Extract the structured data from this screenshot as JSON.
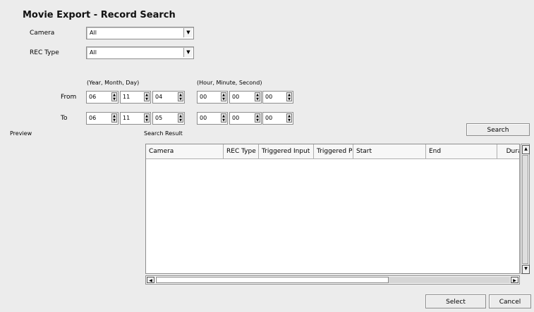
{
  "window": {
    "title": "Movie Export - Record Search"
  },
  "filters": {
    "camera": {
      "label": "Camera",
      "value": "All"
    },
    "rec_type": {
      "label": "REC Type",
      "value": "All"
    }
  },
  "datetime": {
    "date_header": "(Year, Month, Day)",
    "time_header": "(Hour, Minute, Second)",
    "from": {
      "label": "From",
      "year": "06",
      "month": "11",
      "day": "04",
      "hour": "00",
      "minute": "00",
      "second": "00"
    },
    "to": {
      "label": "To",
      "year": "06",
      "month": "11",
      "day": "05",
      "hour": "00",
      "minute": "00",
      "second": "00"
    }
  },
  "preview": {
    "label": "Preview"
  },
  "results": {
    "label": "Search Result",
    "columns": [
      "Camera",
      "REC Type",
      "Triggered Input",
      "Triggered Pin",
      "Start",
      "End",
      "Durat"
    ]
  },
  "buttons": {
    "search": "Search",
    "select": "Select",
    "cancel": "Cancel"
  },
  "icons": {
    "dropdown": "chevron-down-icon",
    "spinner": "up-down-arrows-icon",
    "scroll_up": "arrow-up-icon",
    "scroll_down": "arrow-down-icon",
    "scroll_left": "arrow-left-icon",
    "scroll_right": "arrow-right-icon"
  }
}
